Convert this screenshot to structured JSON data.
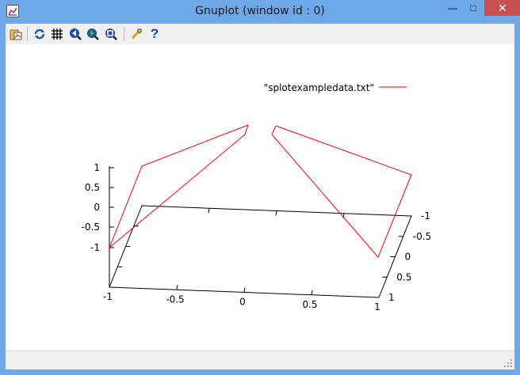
{
  "window": {
    "title": "Gnuplot (window id : 0)",
    "close_glyph": "✕",
    "max_glyph": "□",
    "min_glyph": "—"
  },
  "toolbar": {
    "buttons": [
      {
        "name": "copy-to-clipboard-icon"
      },
      {
        "name": "replot-icon"
      },
      {
        "name": "grid-icon"
      },
      {
        "name": "zoom-previous-icon"
      },
      {
        "name": "zoom-next-icon"
      },
      {
        "name": "autoscale-icon"
      },
      {
        "name": "options-wrench-icon"
      },
      {
        "name": "help-icon",
        "glyph": "?"
      }
    ]
  },
  "chart_data": {
    "type": "line",
    "series": [
      {
        "name": "\"splotexampledata.txt\"",
        "color": "#ff0000"
      }
    ],
    "axes": {
      "x_ticks": [
        "-1",
        "-0.5",
        "0",
        "0.5",
        "1"
      ],
      "y_ticks": [
        "-1",
        "-0.5",
        "0",
        "0.5",
        "1"
      ],
      "z_ticks": [
        "1",
        "0.5",
        "0",
        "-0.5",
        "-1"
      ]
    },
    "xlim": [
      -1,
      1
    ],
    "ylim": [
      -1,
      1
    ],
    "zlim": [
      -1,
      1
    ],
    "legend_position": "top-right"
  }
}
